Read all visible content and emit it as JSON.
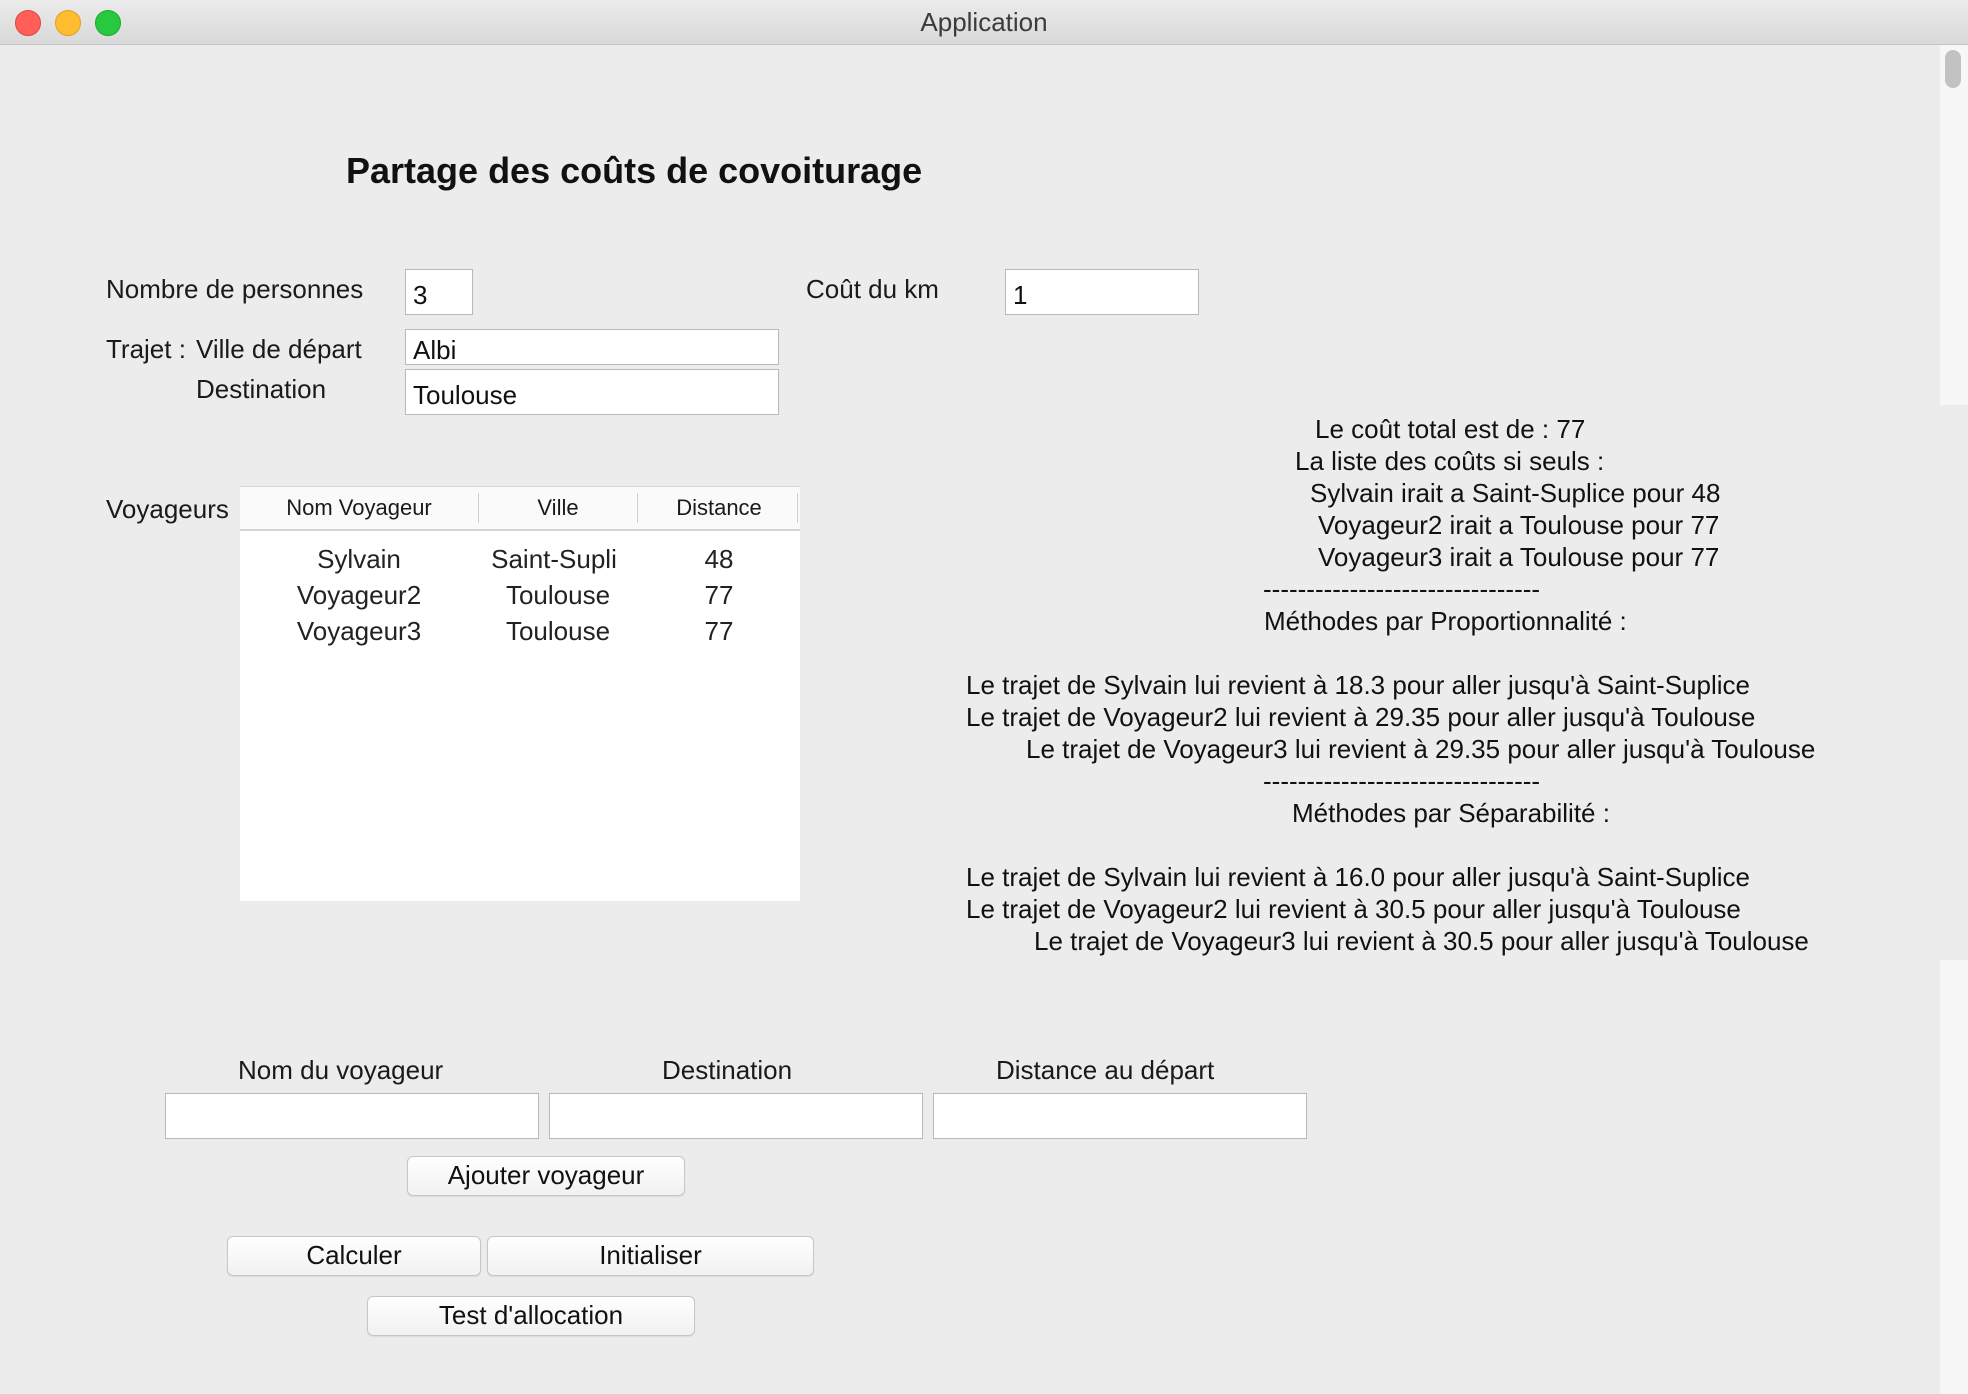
{
  "window": {
    "title": "Application"
  },
  "heading": "Partage des coûts de covoiturage",
  "form": {
    "nb_personnes_label": "Nombre de personnes",
    "nb_personnes_value": "3",
    "cout_km_label": "Coût du km",
    "cout_km_value": "1",
    "trajet_label": "Trajet :",
    "ville_depart_label": "Ville de départ",
    "ville_depart_value": "Albi",
    "destination_label": "Destination",
    "destination_value": "Toulouse"
  },
  "voyageurs": {
    "label": "Voyageurs",
    "columns": [
      "Nom Voyageur",
      "Ville",
      "Distance"
    ],
    "rows": [
      [
        "Sylvain",
        "Saint-Supli",
        "48"
      ],
      [
        "Voyageur2",
        "Toulouse",
        "77"
      ],
      [
        "Voyageur3",
        "Toulouse",
        "77"
      ]
    ]
  },
  "results": {
    "lines": [
      "Le coût total est de : 77",
      "La liste des coûts si seuls :",
      "Sylvain irait a Saint-Suplice pour 48",
      "Voyageur2 irait a Toulouse pour 77",
      "Voyageur3 irait a Toulouse pour 77",
      "--------------------------------",
      "Méthodes par Proportionnalité :",
      "",
      "Le trajet de Sylvain lui revient à 18.3 pour aller jusqu'à Saint-Suplice",
      "Le trajet de Voyageur2 lui revient à 29.35 pour aller jusqu'à Toulouse",
      "Le trajet de Voyageur3 lui revient à 29.35 pour aller jusqu'à Toulouse",
      "--------------------------------",
      "Méthodes par Séparabilité :",
      "",
      "Le trajet de Sylvain lui revient à 16.0 pour aller jusqu'à Saint-Suplice",
      "Le trajet de Voyageur2 lui revient à 30.5 pour aller jusqu'à Toulouse",
      "Le trajet de Voyageur3 lui revient à 30.5 pour aller jusqu'à Toulouse"
    ]
  },
  "add_form": {
    "nom_label": "Nom du voyageur",
    "nom_value": "",
    "destination_label": "Destination",
    "destination_value": "",
    "distance_label": "Distance au départ",
    "distance_value": ""
  },
  "buttons": {
    "ajouter": "Ajouter voyageur",
    "calculer": "Calculer",
    "initialiser": "Initialiser",
    "test": "Test d'allocation"
  },
  "colors": {
    "close": "#ff5f57",
    "minimize": "#febc2e",
    "maximize": "#28c840",
    "background": "#ececec"
  }
}
